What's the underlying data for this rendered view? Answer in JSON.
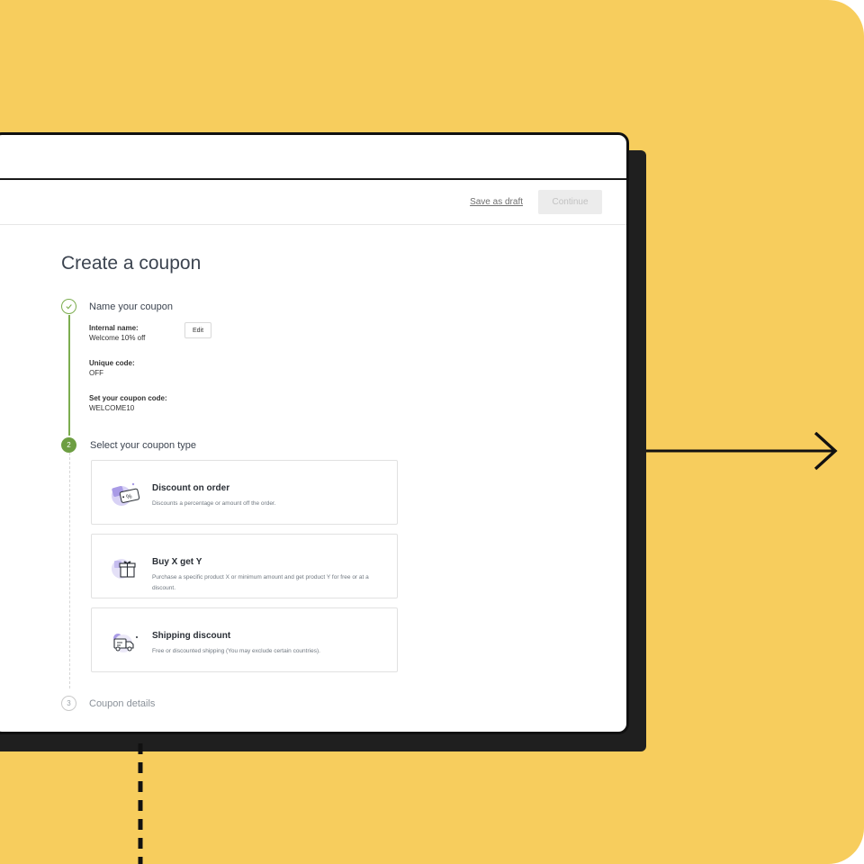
{
  "toolbar": {
    "save_draft": "Save as draft",
    "continue": "Continue"
  },
  "page": {
    "title": "Create a coupon"
  },
  "steps": [
    {
      "number": "",
      "label": "Name your coupon"
    },
    {
      "number": "2",
      "label": "Select your coupon type"
    },
    {
      "number": "3",
      "label": "Coupon details"
    }
  ],
  "fields": {
    "internal_name_label": "Internal name:",
    "internal_name_value": "Welcome 10% off",
    "unique_code_label": "Unique code:",
    "unique_code_value": "OFF",
    "coupon_code_label": "Set your coupon code:",
    "coupon_code_value": "WELCOME10",
    "edit": "Edit"
  },
  "coupon_types": [
    {
      "title": "Discount on order",
      "description": "Discounts a percentage or amount off the order.",
      "icon": "tag-percent-icon"
    },
    {
      "title": "Buy X get Y",
      "description": "Purchase a specific product X or minimum amount and get product Y for free or at a discount.",
      "icon": "gift-icon"
    },
    {
      "title": "Shipping discount",
      "description": "Free or discounted shipping (You may exclude certain countries).",
      "icon": "truck-icon"
    }
  ],
  "colors": {
    "background": "#F7CD5D",
    "accent_green": "#6d9e42",
    "icon_purple": "#b8b0e8"
  }
}
